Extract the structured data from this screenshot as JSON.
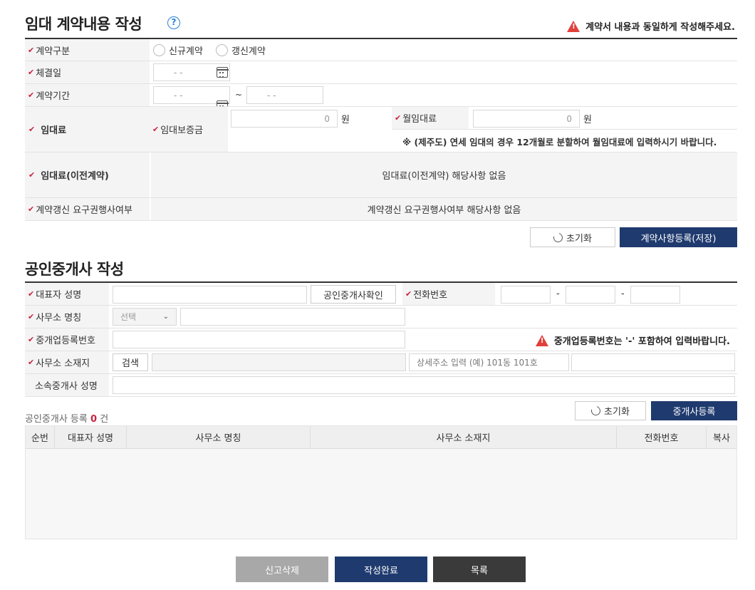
{
  "contract": {
    "title": "임대 계약내용 작성",
    "warning": "계약서 내용과 동일하게 작성해주세요.",
    "type_label": "계약구분",
    "type_options": [
      "신규계약",
      "갱신계약"
    ],
    "date_label": "체결일",
    "period_label": "계약기간",
    "date_placeholder": "-   -",
    "period_sep": "~",
    "rent_label": "임대료",
    "deposit_label": "임대보증금",
    "deposit_value": "0",
    "won": "원",
    "monthly_label": "월임대료",
    "monthly_value": "0",
    "jeju_note": "※ (제주도) 연세 임대의 경우 12개월로 분할하여 월임대료에 입력하시기 바랍니다.",
    "prev_rent_label": "임대료(이전계약)",
    "prev_rent_text": "임대료(이전계약) 해당사항 없음",
    "renewal_label": "계약갱신 요구권행사여부",
    "renewal_text": "계약갱신 요구권행사여부 해당사항 없음",
    "reset_label": "초기화",
    "save_label": "계약사항등록(저장)"
  },
  "broker": {
    "title": "공인중개사 작성",
    "rep_name_label": "대표자 성명",
    "verify_label": "공인중개사확인",
    "phone_label": "전화번호",
    "phone_sep": "-",
    "office_name_label": "사무소 명칭",
    "select_value": "선택",
    "reg_no_label": "중개업등록번호",
    "reg_warning": "중개업등록번호는 '-' 포함하여 입력바랍니다.",
    "office_addr_label": "사무소 소재지",
    "search_label": "검색",
    "detail_placeholder": "상세주소 입력 (예) 101동 101호",
    "member_label": "소속중개사 성명",
    "count_prefix": "공인중개사 등록",
    "count": "0",
    "count_suffix": "건",
    "reset_label": "초기화",
    "register_label": "중개사등록",
    "table_headers": [
      "순번",
      "대표자 성명",
      "사무소 명칭",
      "사무소 소재지",
      "전화번호",
      "복사"
    ]
  },
  "footer": {
    "delete_label": "신고삭제",
    "complete_label": "작성완료",
    "list_label": "목록"
  },
  "colors": {
    "navy": "#1f3a6e",
    "red": "#c8243e",
    "warn": "#e0403a"
  }
}
